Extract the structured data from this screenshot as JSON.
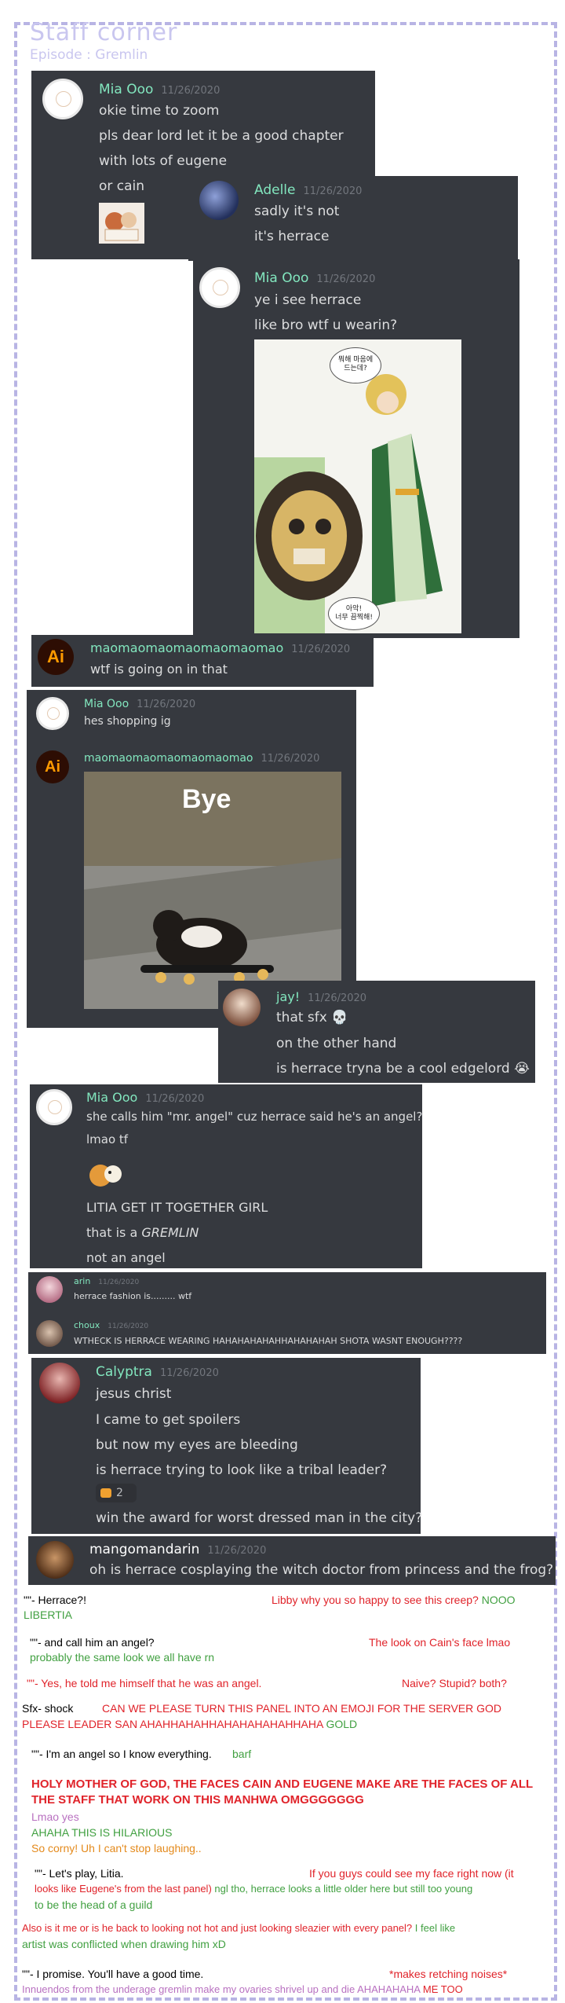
{
  "header": {
    "title": "Staff corner",
    "subtitle": "Episode : Gremlin"
  },
  "messages": {
    "m1": {
      "name": "Mia Ooo",
      "time": "11/26/2020",
      "lines": [
        "okie time to zoom",
        "pls dear lord let it be a good chapter",
        "with lots of eugene",
        "or cain"
      ]
    },
    "m2": {
      "name": "Adelle",
      "time": "11/26/2020",
      "lines": [
        "sadly it's not",
        "it's herrace"
      ]
    },
    "m3": {
      "name": "Mia Ooo",
      "time": "11/26/2020",
      "lines": [
        "ye i see herrace",
        "like bro wtf u wearin?"
      ],
      "bubble_top": "뭐해 마음에\n드는데?",
      "bubble_bottom": "아악!\n너무 끔찍해!"
    },
    "m4": {
      "name": "maomaomaomaomaomaomao",
      "time": "11/26/2020",
      "lines": [
        "wtf is going on in that"
      ],
      "avatar_text": "Ai"
    },
    "m5": {
      "name": "Mia Ooo",
      "time": "11/26/2020",
      "lines": [
        "hes shopping ig"
      ]
    },
    "m6": {
      "name": "maomaomaomaomaomaomao",
      "time": "11/26/2020",
      "avatar_text": "Ai",
      "image_caption": "Bye"
    },
    "m7": {
      "name": "jay!",
      "time": "11/26/2020",
      "lines": [
        "that sfx 💀",
        "on the other hand",
        "is herrace tryna be a cool edgelord 😭"
      ]
    },
    "m8": {
      "name": "Mia Ooo",
      "time": "11/26/2020",
      "lines": [
        "she calls him \"mr. angel\" cuz herrace said he's an angel?",
        "lmao tf",
        "LITIA GET IT TOGETHER GIRL",
        "that is a ",
        "GREMLIN",
        "not an angel"
      ]
    },
    "m9": {
      "name": "arin",
      "time": "11/26/2020",
      "lines": [
        "herrace fashion is......... wtf"
      ]
    },
    "m10": {
      "name": "choux",
      "time": "11/26/2020",
      "lines": [
        "WTHECK IS HERRACE WEARING HAHAHAHAHAHHAHAHAHAH SHOTA WASNT ENOUGH????"
      ]
    },
    "m11": {
      "name": "Calyptra",
      "time": "11/26/2020",
      "lines": [
        "jesus christ",
        "I came to get spoilers",
        "but now my eyes are bleeding",
        "is herrace trying to look like a tribal leader?",
        "win the award for worst dressed man in the city?"
      ],
      "reaction_count": "2"
    },
    "m12": {
      "name": "mangomandarin",
      "time": "11/26/2020",
      "lines": [
        "oh is herrace cosplaying the witch doctor from princess and the frog?"
      ]
    }
  },
  "notes": [
    {
      "segments": [
        {
          "c": "blk",
          "t": "\"\"- Herrace?!"
        },
        {
          "c": "red",
          "t": "Libby why you so happy to see this creep?"
        },
        {
          "c": "grn",
          "t": " NOOO"
        }
      ],
      "line2": {
        "c": "grn",
        "t": "LIBERTIA"
      }
    },
    {
      "segments": [
        {
          "c": "blk",
          "t": "\"\"- and call him an angel?"
        },
        {
          "c": "red",
          "t": "The look on Cain's face lmao"
        }
      ],
      "line2": {
        "c": "grn",
        "t": "probably the same look we all have rn"
      }
    },
    {
      "segments": [
        {
          "c": "red",
          "t": "\"\"- Yes, he told me himself that he was an angel."
        },
        {
          "c": "red",
          "t": "Naive? Stupid? both?"
        }
      ]
    },
    {
      "segments": [
        {
          "c": "blk",
          "t": "Sfx- shock"
        },
        {
          "c": "red",
          "t": "CAN WE PLEASE TURN THIS PANEL INTO AN EMOJI FOR THE SERVER GOD"
        }
      ],
      "line2": {
        "c": "red",
        "t": "PLEASE LEADER SAN AHAHHAHAHHAHAHAHAHAHHAHA",
        "extra": " GOLD"
      }
    },
    {
      "segments": [
        {
          "c": "blk",
          "t": "\"\"- I'm an angel so I know everything."
        },
        {
          "c": "grn",
          "t": "barf"
        }
      ]
    },
    {
      "lines": [
        {
          "c": "red",
          "t": "HOLY MOTHER OF GOD, THE FACES CAIN AND EUGENE MAKE ARE THE FACES OF ALL"
        },
        {
          "c": "red",
          "t": "THE STAFF THAT WORK ON THIS MANHWA OMGGGGGGG"
        },
        {
          "c": "pur",
          "t": "Lmao yes"
        },
        {
          "c": "grn",
          "t": "AHAHA THIS IS HILARIOUS"
        },
        {
          "c": "org",
          "t": "So corny! Uh I can't stop laughing.."
        }
      ]
    },
    {
      "segments": [
        {
          "c": "blk",
          "t": "\"\"- Let's play, Litia."
        },
        {
          "c": "red",
          "t": "If you guys could see my face right now (it"
        }
      ],
      "lines": [
        {
          "c": "red",
          "t": "looks like Eugene's from the last panel)",
          "extra": " ngl tho, herrace looks a little older here but still too young"
        },
        {
          "c": "grn",
          "t": "to be the head of a guild"
        }
      ]
    },
    {
      "lines": [
        {
          "c": "red",
          "t": "Also is it me or is he back to looking not hot and just looking sleazier with every panel?",
          "extra": " I feel like"
        },
        {
          "c": "grn",
          "t": "artist was conflicted when drawing him xD"
        }
      ]
    },
    {
      "segments": [
        {
          "c": "blk",
          "t": "\"\"- I promise. You'll have a good time."
        },
        {
          "c": "red",
          "t": "*makes retching noises*"
        }
      ],
      "line2": {
        "c": "pur",
        "t": "Innuendos from the underage gremlin make my ovaries shrivel up and die AHAHAHAHA",
        "extra": " ME TOO"
      }
    }
  ]
}
